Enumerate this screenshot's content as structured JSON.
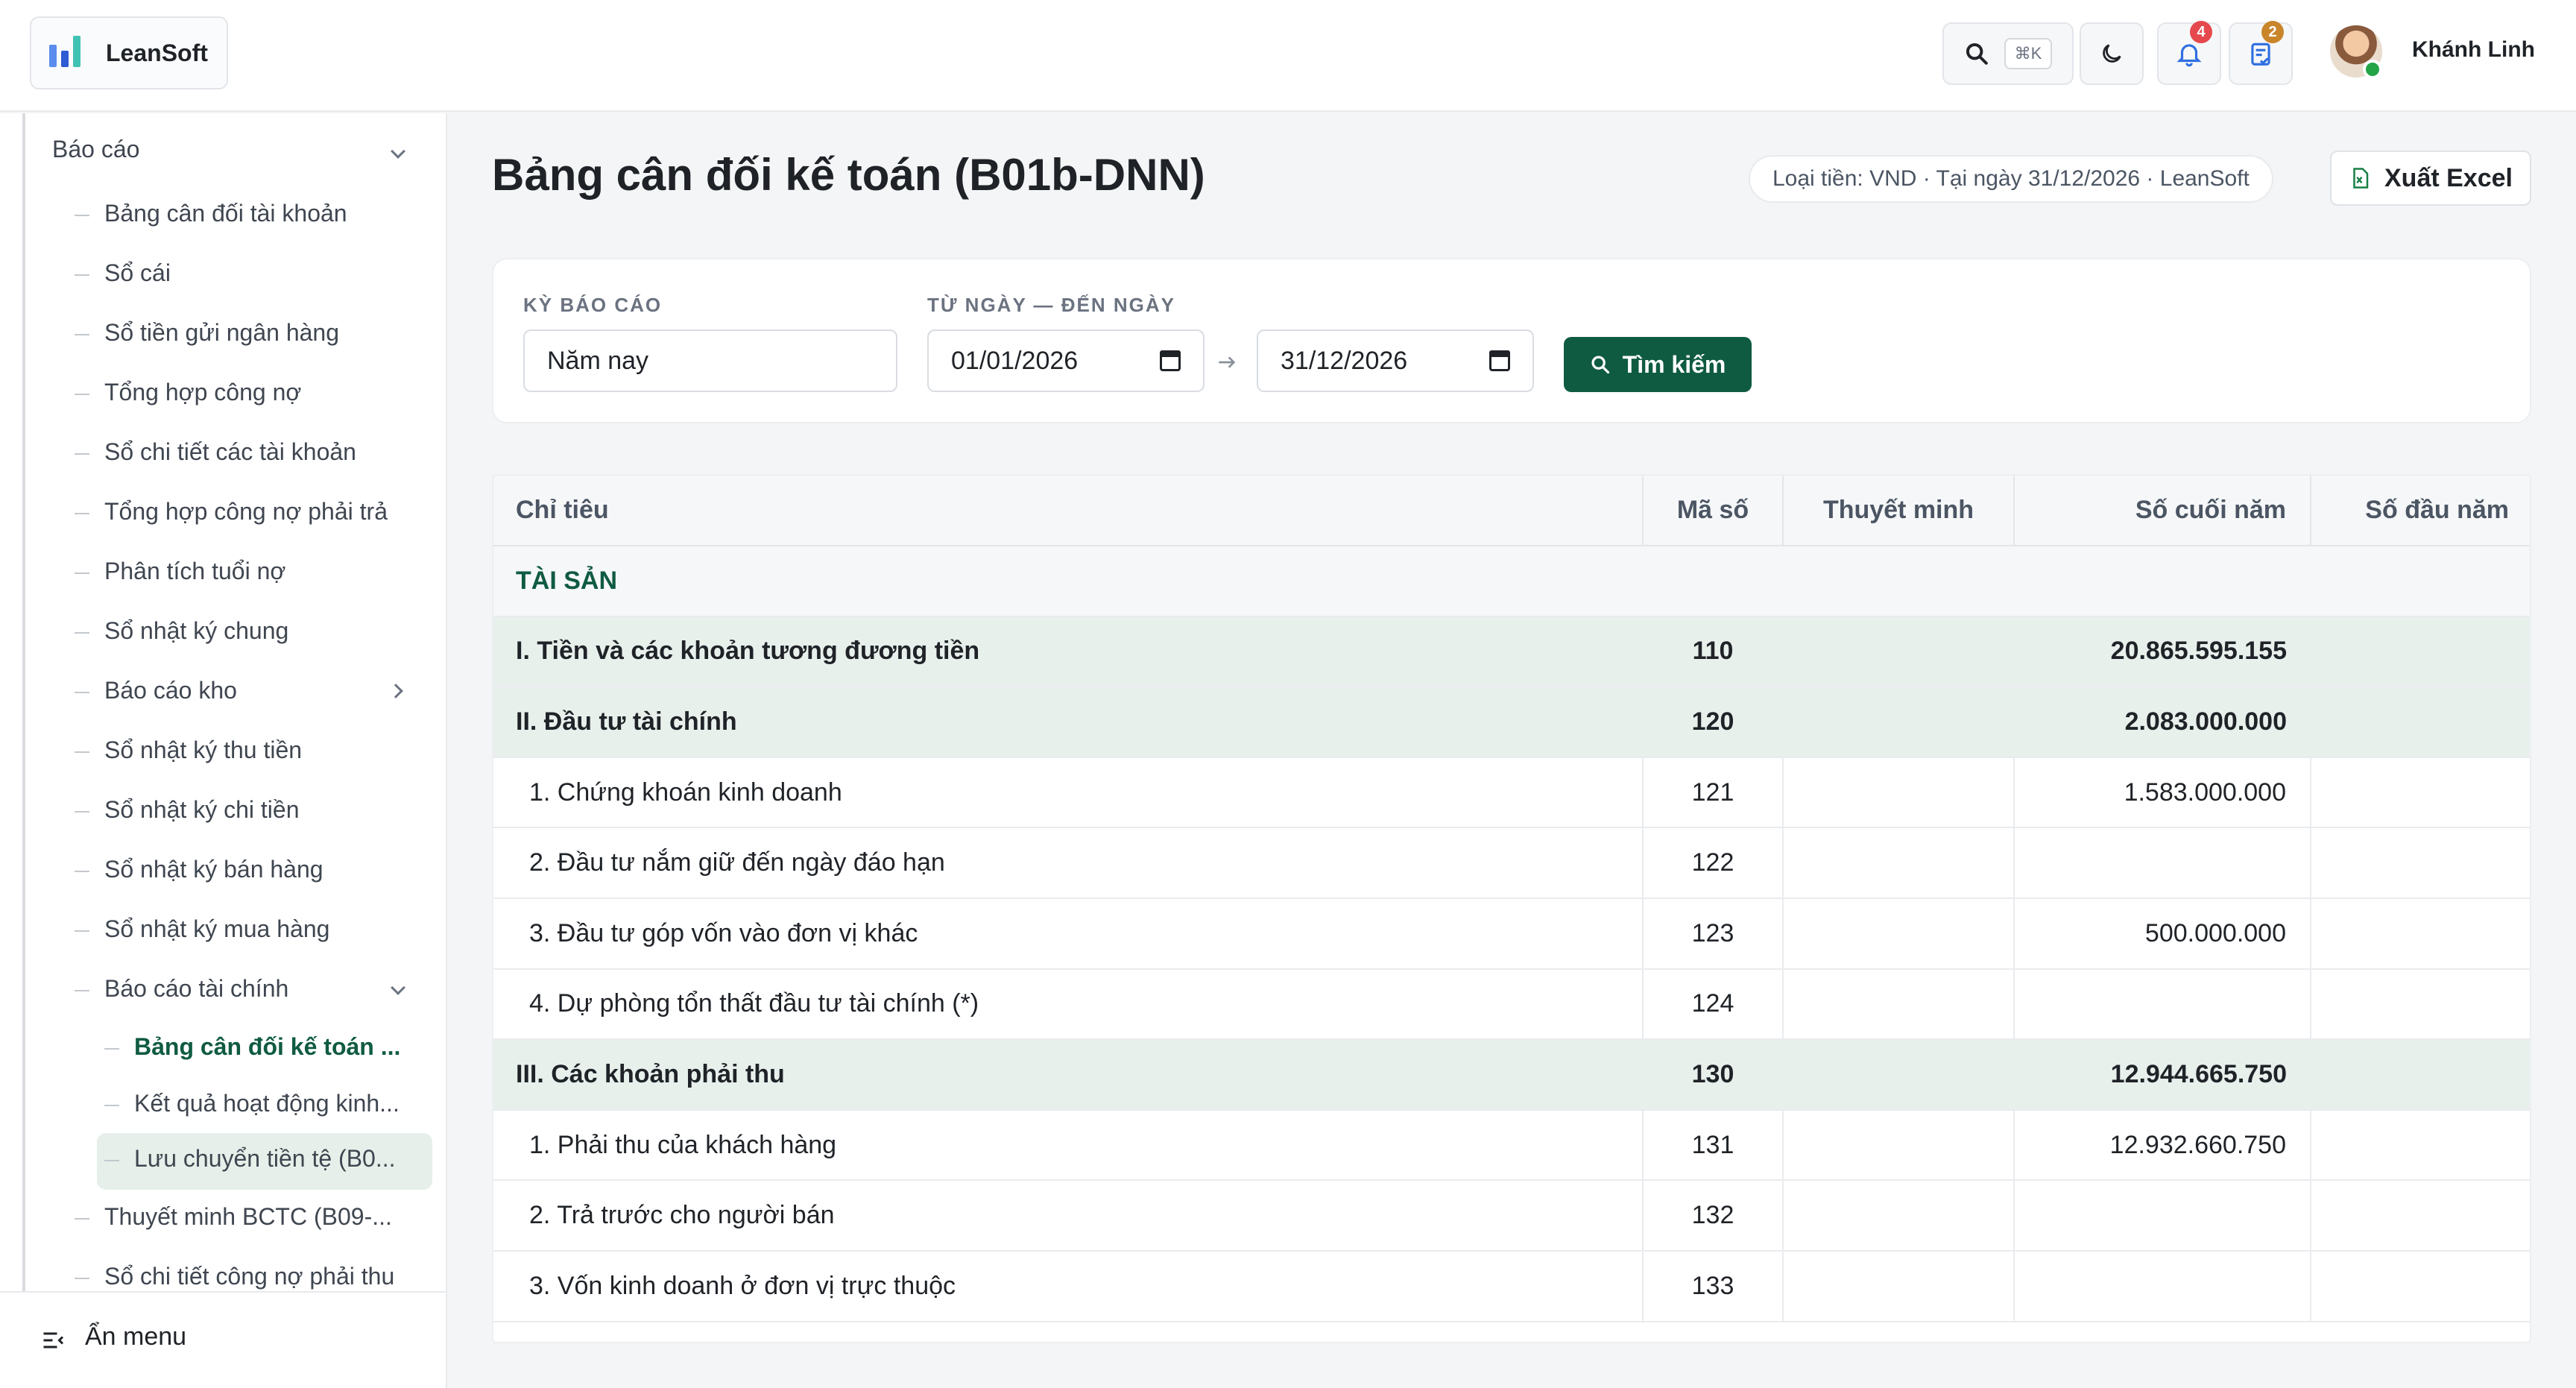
{
  "header": {
    "app_name": "LeanSoft",
    "search_shortcut": "⌘K",
    "notifications_count": "4",
    "tasks_count": "2",
    "user_name": "Khánh Linh"
  },
  "sidebar": {
    "group": "Báo cáo",
    "items": [
      "Bảng cân đối tài khoản",
      "Sổ cái",
      "Sổ tiền gửi ngân hàng",
      "Tổng hợp công nợ",
      "Sổ chi tiết các tài khoản",
      "Tổng hợp công nợ phải trả",
      "Phân tích tuổi nợ",
      "Sổ nhật ký chung",
      "Báo cáo kho",
      "Sổ nhật ký thu tiền",
      "Sổ nhật ký chi tiền",
      "Sổ nhật ký bán hàng",
      "Sổ nhật ký mua hàng",
      "Báo cáo tài chính"
    ],
    "sub_items": [
      "Bảng cân đối kế toán ...",
      "Kết quả hoạt động kinh...",
      "Lưu chuyển tiền tệ (B0..."
    ],
    "items_after": [
      "Thuyết minh BCTC (B09-...",
      "Sổ chi tiết công nợ phải thu"
    ],
    "hide_menu": "Ẩn menu"
  },
  "page": {
    "title": "Bảng cân đối kế toán (B01b-DNN)",
    "meta": "Loại tiền: VND · Tại ngày 31/12/2026 · LeanSoft",
    "export_label": "Xuất Excel"
  },
  "filters": {
    "period_label": "KỲ BÁO CÁO",
    "period_value": "Năm nay",
    "range_label": "TỪ NGÀY — ĐẾN NGÀY",
    "from_date": "01/01/2026",
    "to_date": "31/12/2026",
    "search_label": "Tìm kiếm"
  },
  "table": {
    "headers": [
      "Chỉ tiêu",
      "Mã số",
      "Thuyết minh",
      "Số cuối năm",
      "Số đầu năm"
    ],
    "section": "TÀI SẢN",
    "rows": [
      {
        "type": "group",
        "name": "I. Tiền và các khoản tương đương tiền",
        "code": "110",
        "note": "",
        "end": "20.865.595.155",
        "start": ""
      },
      {
        "type": "group",
        "name": "II. Đầu tư tài chính",
        "code": "120",
        "note": "",
        "end": "2.083.000.000",
        "start": ""
      },
      {
        "type": "item",
        "name": "1. Chứng khoán kinh doanh",
        "code": "121",
        "note": "",
        "end": "1.583.000.000",
        "start": ""
      },
      {
        "type": "item",
        "name": "2. Đầu tư nắm giữ đến ngày đáo hạn",
        "code": "122",
        "note": "",
        "end": "",
        "start": ""
      },
      {
        "type": "item",
        "name": "3. Đầu tư góp vốn vào đơn vị khác",
        "code": "123",
        "note": "",
        "end": "500.000.000",
        "start": ""
      },
      {
        "type": "item",
        "name": "4. Dự phòng tổn thất đầu tư tài chính (*)",
        "code": "124",
        "note": "",
        "end": "",
        "start": ""
      },
      {
        "type": "group",
        "name": "III. Các khoản phải thu",
        "code": "130",
        "note": "",
        "end": "12.944.665.750",
        "start": ""
      },
      {
        "type": "item",
        "name": "1. Phải thu của khách hàng",
        "code": "131",
        "note": "",
        "end": "12.932.660.750",
        "start": ""
      },
      {
        "type": "item",
        "name": "2. Trả trước cho người bán",
        "code": "132",
        "note": "",
        "end": "",
        "start": ""
      },
      {
        "type": "item",
        "name": "3. Vốn kinh doanh ở đơn vị trực thuộc",
        "code": "133",
        "note": "",
        "end": "",
        "start": ""
      }
    ]
  },
  "colors": {
    "accent": "#0f5b42",
    "accent_light": "#e6efe9",
    "badge_red": "#e5484d",
    "badge_orange": "#c9852a"
  }
}
